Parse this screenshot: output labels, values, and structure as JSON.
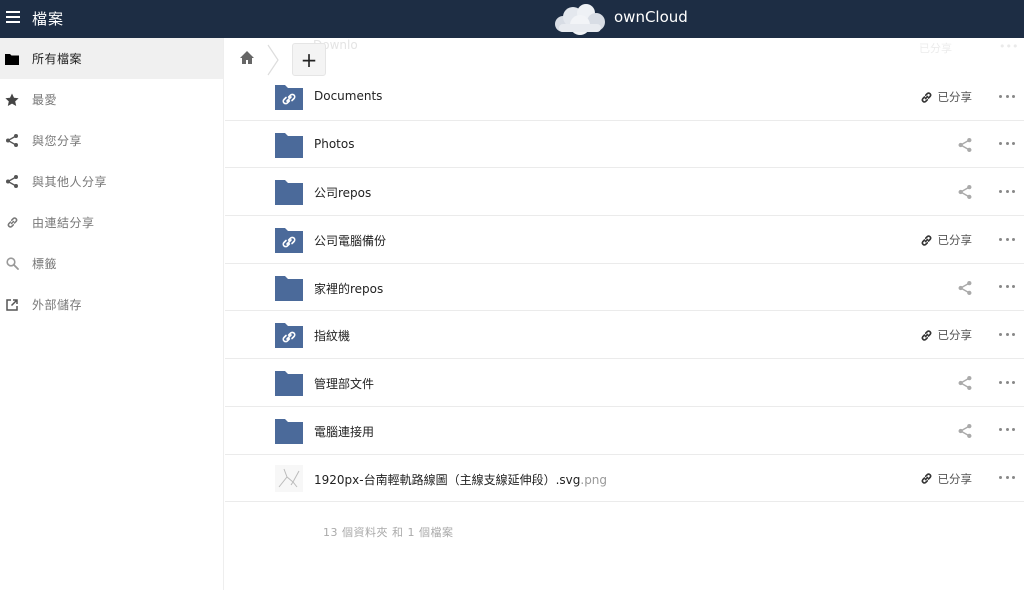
{
  "header": {
    "app_title": "檔案",
    "brand": "ownCloud"
  },
  "sidebar": {
    "items": [
      {
        "label": "所有檔案",
        "icon": "folder-icon"
      },
      {
        "label": "最愛",
        "icon": "star-icon"
      },
      {
        "label": "與您分享",
        "icon": "share-icon"
      },
      {
        "label": "與其他人分享",
        "icon": "share-icon"
      },
      {
        "label": "由連結分享",
        "icon": "link-icon"
      },
      {
        "label": "標籤",
        "icon": "search-icon"
      },
      {
        "label": "外部儲存",
        "icon": "external-icon"
      }
    ]
  },
  "controls": {
    "new_label": "+",
    "ghost_text": "Downlo",
    "ghost_share": "已分享",
    "ghost_more": "•••"
  },
  "files": [
    {
      "name": "Documents",
      "ext": "",
      "type": "shared-folder",
      "shared": true,
      "share_label": "已分享"
    },
    {
      "name": "Photos",
      "ext": "",
      "type": "folder",
      "shared": false,
      "share_label": ""
    },
    {
      "name": "公司repos",
      "ext": "",
      "type": "folder",
      "shared": false,
      "share_label": ""
    },
    {
      "name": "公司電腦備份",
      "ext": "",
      "type": "shared-folder",
      "shared": true,
      "share_label": "已分享"
    },
    {
      "name": "家裡的repos",
      "ext": "",
      "type": "folder",
      "shared": false,
      "share_label": ""
    },
    {
      "name": "指紋機",
      "ext": "",
      "type": "shared-folder",
      "shared": true,
      "share_label": "已分享"
    },
    {
      "name": "管理部文件",
      "ext": "",
      "type": "folder",
      "shared": false,
      "share_label": ""
    },
    {
      "name": "電腦連接用",
      "ext": "",
      "type": "folder",
      "shared": false,
      "share_label": ""
    },
    {
      "name": "1920px-台南輕軌路線圖（主線支線延伸段）.svg",
      "ext": ".png",
      "type": "image",
      "shared": true,
      "share_label": "已分享"
    }
  ],
  "summary": "13 個資料夾 和 1 個檔案",
  "colors": {
    "header_bg": "#1d2d44",
    "folder": "#4b6a9a",
    "active_nav": "#f0f0f0"
  }
}
